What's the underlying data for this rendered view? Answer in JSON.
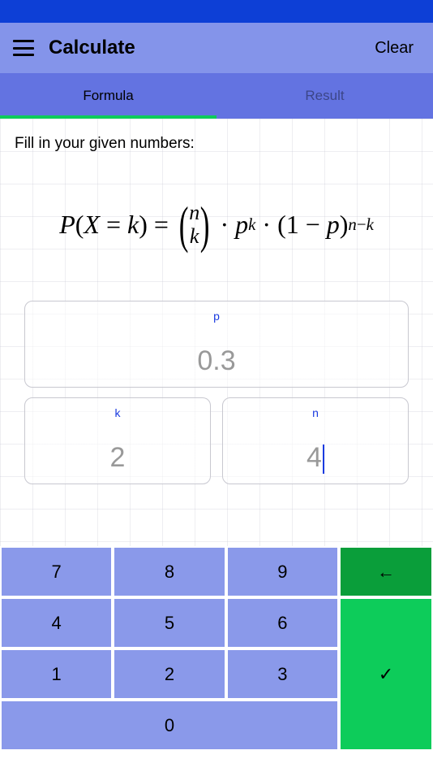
{
  "header": {
    "title": "Calculate",
    "clear_label": "Clear"
  },
  "tabs": {
    "formula": "Formula",
    "result": "Result"
  },
  "content": {
    "instruction": "Fill in your given numbers:",
    "formula": {
      "lhs_P": "P",
      "lhs_X": "X",
      "lhs_eq": "=",
      "lhs_k": "k",
      "binom_n": "n",
      "binom_k": "k",
      "p": "p",
      "exp_k": "k",
      "one": "1",
      "minus": "−",
      "exp_n": "n",
      "exp_minus": "−",
      "exp_k2": "k"
    }
  },
  "inputs": {
    "p": {
      "label": "p",
      "value": "0.3"
    },
    "k": {
      "label": "k",
      "value": "2"
    },
    "n": {
      "label": "n",
      "value": "4"
    }
  },
  "keypad": {
    "k7": "7",
    "k8": "8",
    "k9": "9",
    "k4": "4",
    "k5": "5",
    "k6": "6",
    "k1": "1",
    "k2": "2",
    "k3": "3",
    "k0": "0",
    "back": "←",
    "enter": "✓"
  }
}
